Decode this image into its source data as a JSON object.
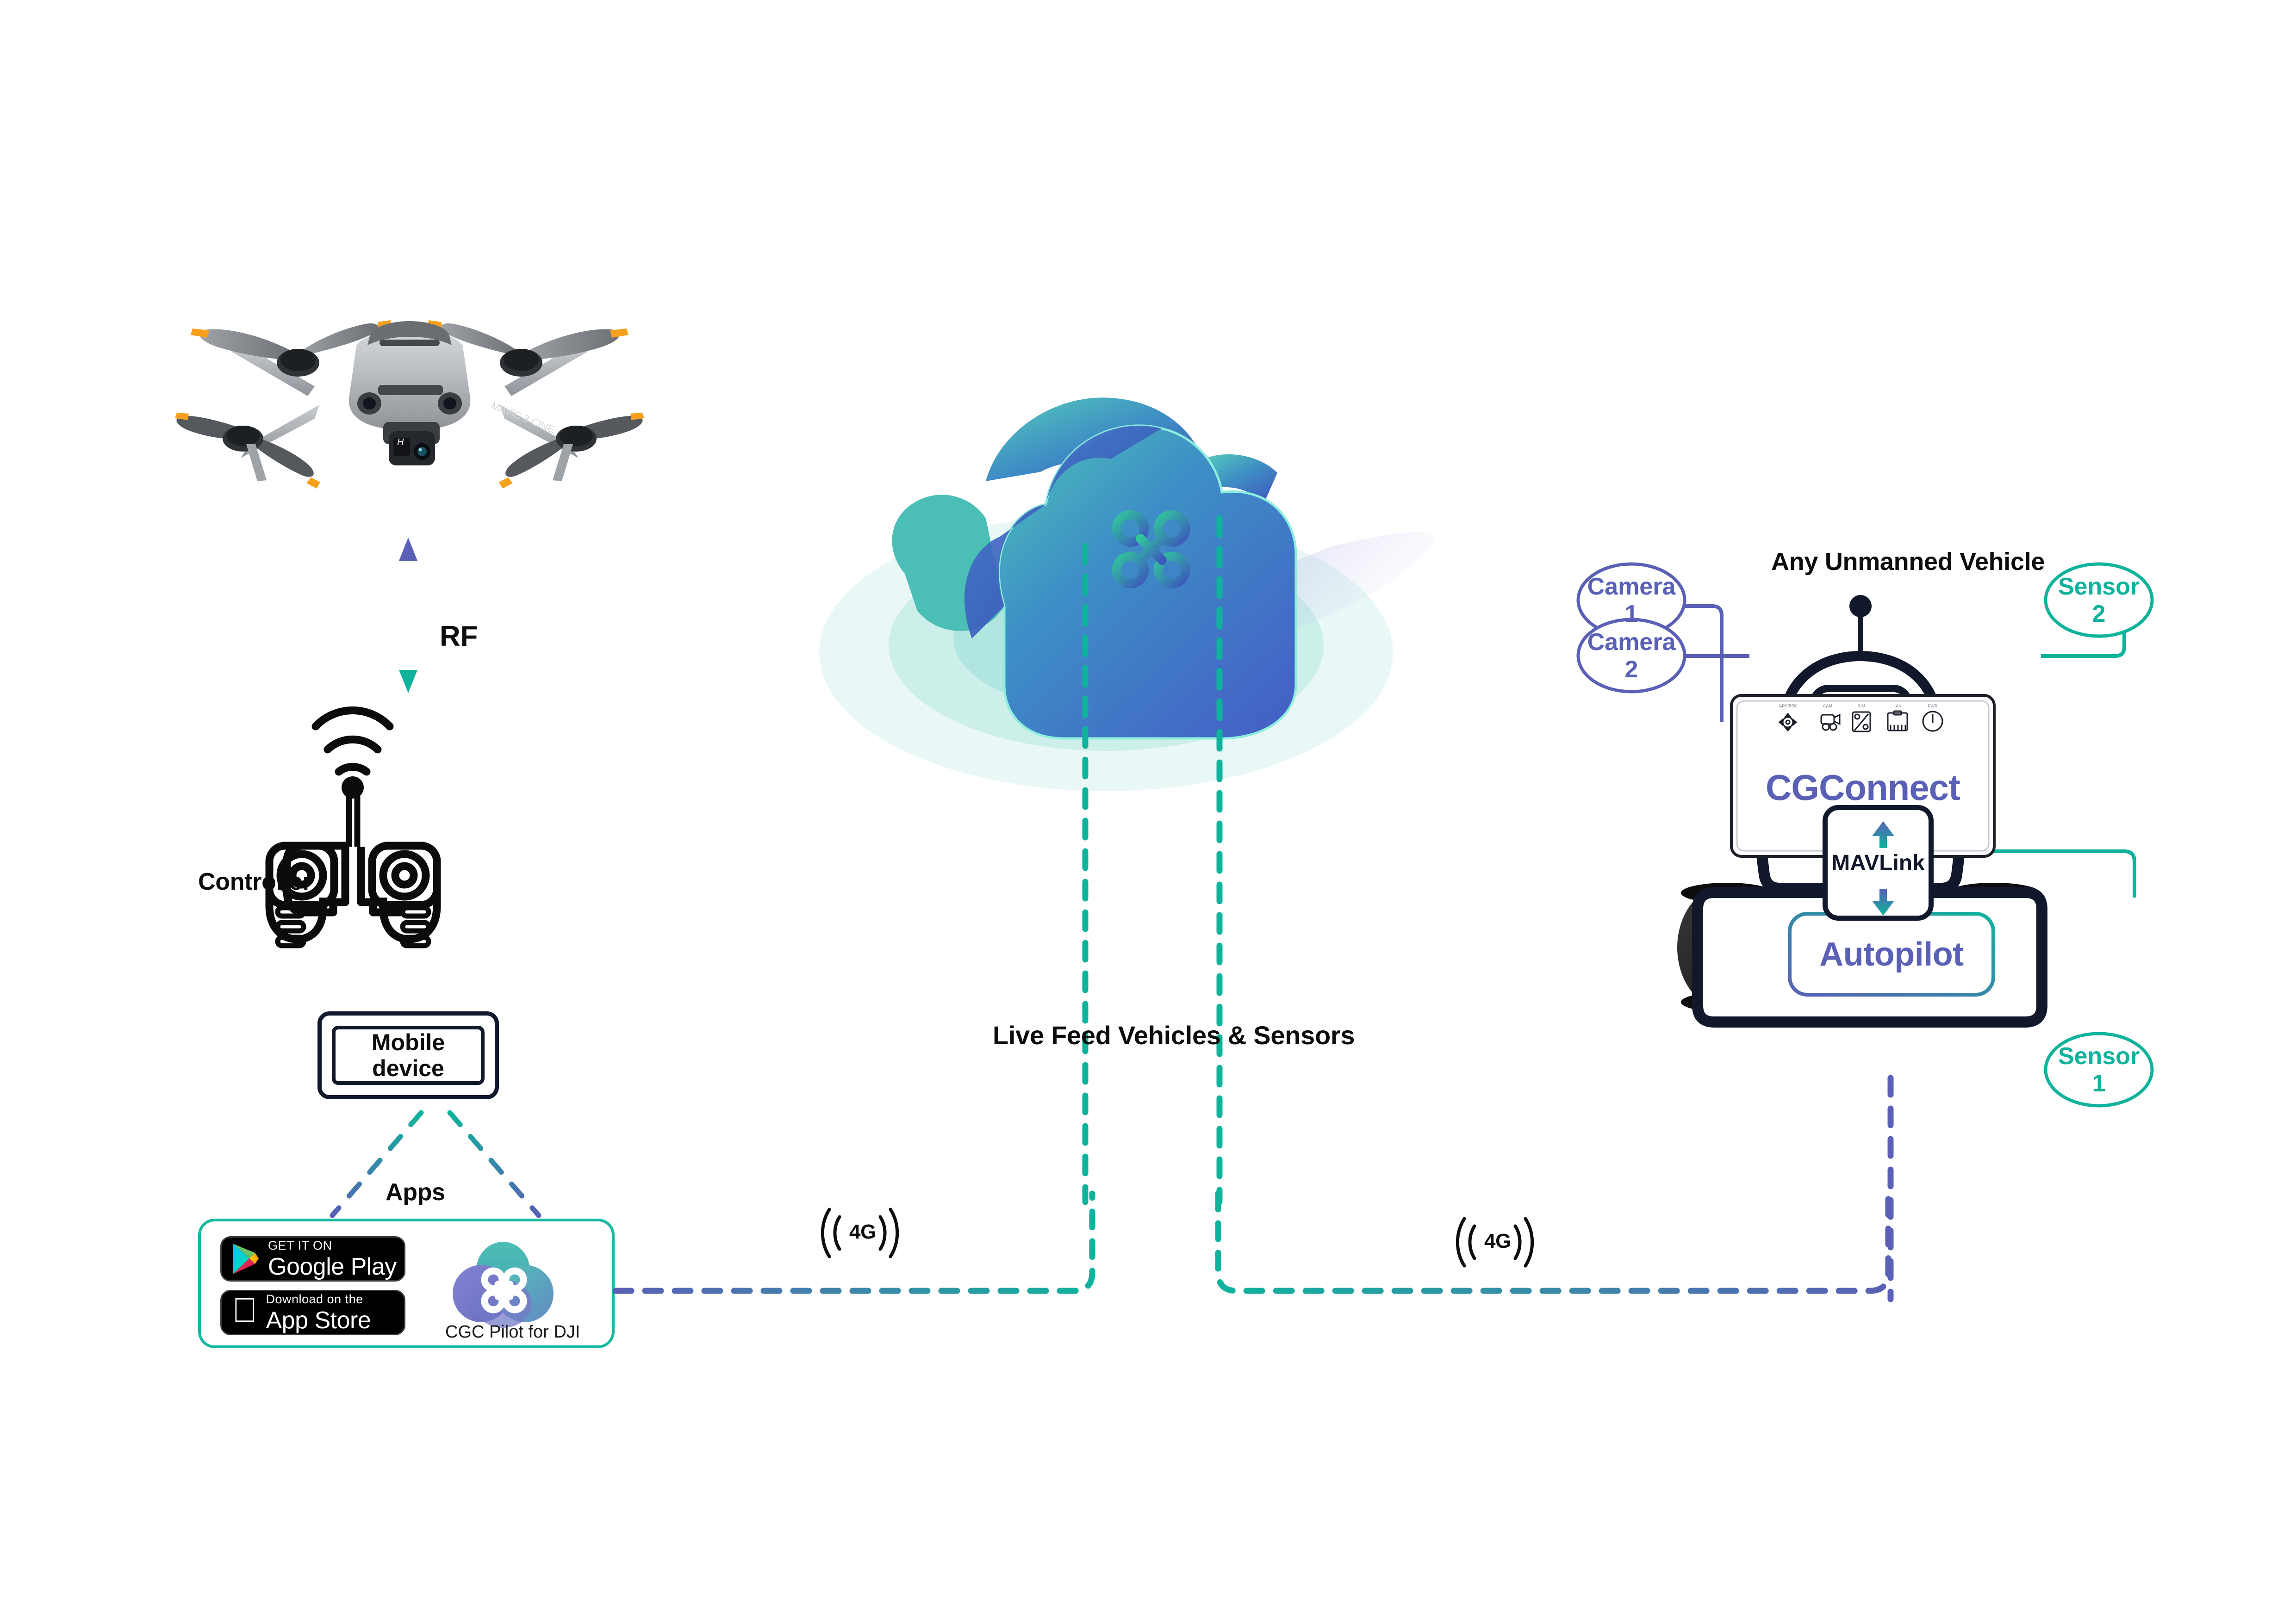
{
  "diagram": {
    "title_hidden": "",
    "labels": {
      "rf": "RF",
      "controller": "Controller",
      "mobile_device": "Mobile\ndevice",
      "mobile_device_line1": "Mobile",
      "mobile_device_line2": "device",
      "apps": "Apps",
      "live_feed": "Live Feed Vehicles & Sensors",
      "any_unmanned_vehicle": "Any Unmanned Vehicle",
      "mavlink": "MAVLink",
      "cgconnect": "CGConnect",
      "autopilot": "Autopilot",
      "cgc_pilot": "CGC Pilot for DJI",
      "network_left": "4G",
      "network_right": "4G"
    },
    "app_badges": [
      {
        "id": "google-play",
        "top_text": "GET IT ON",
        "main_text": "Google Play"
      },
      {
        "id": "app-store",
        "top_text": "Download on the",
        "main_text": "App Store"
      }
    ],
    "nodes": [
      {
        "id": "camera-1",
        "line1": "Camera",
        "line2": "1",
        "color": "#5a60b5"
      },
      {
        "id": "camera-2",
        "line1": "Camera",
        "line2": "2",
        "color": "#5a60b5"
      },
      {
        "id": "sensor-2",
        "line1": "Sensor",
        "line2": "2",
        "color": "#0fb39c"
      },
      {
        "id": "sensor-1",
        "line1": "Sensor",
        "line2": "1",
        "color": "#0fb39c"
      }
    ],
    "colors": {
      "purple": "#5a60b5",
      "teal": "#0fb39c",
      "teal_light": "#16b8a0",
      "ink": "#11182b",
      "black": "#0d0d0d",
      "cloud_blue": "#3f6fc0",
      "cloud_teal": "#3fc0b0",
      "drone_grey": "#b3b7bb",
      "drone_dark": "#4a4d52",
      "drone_orange": "#f7a01d",
      "tire_black": "#231f20",
      "chassis_grey": "#e2e4e7"
    }
  }
}
